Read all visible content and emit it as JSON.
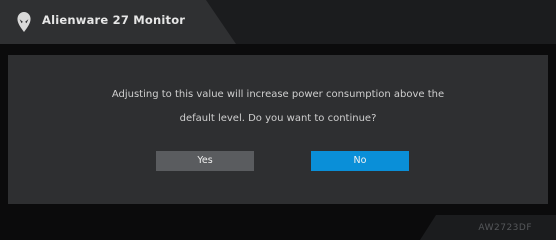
{
  "header": {
    "title": "Alienware 27 Monitor",
    "logo_icon": "alienware-alien-head-icon"
  },
  "dialog": {
    "message_line1": "Adjusting to this value will increase power consumption above the",
    "message_line2": "default level. Do you want to continue?",
    "yes_label": "Yes",
    "no_label": "No"
  },
  "footer": {
    "model": "AW2723DF"
  },
  "colors": {
    "accent": "#0A8FD8",
    "background": "#0B0B0C",
    "panel": "#2E2F31",
    "header_tab": "#2F3032",
    "button_secondary": "#5A5C5F"
  }
}
